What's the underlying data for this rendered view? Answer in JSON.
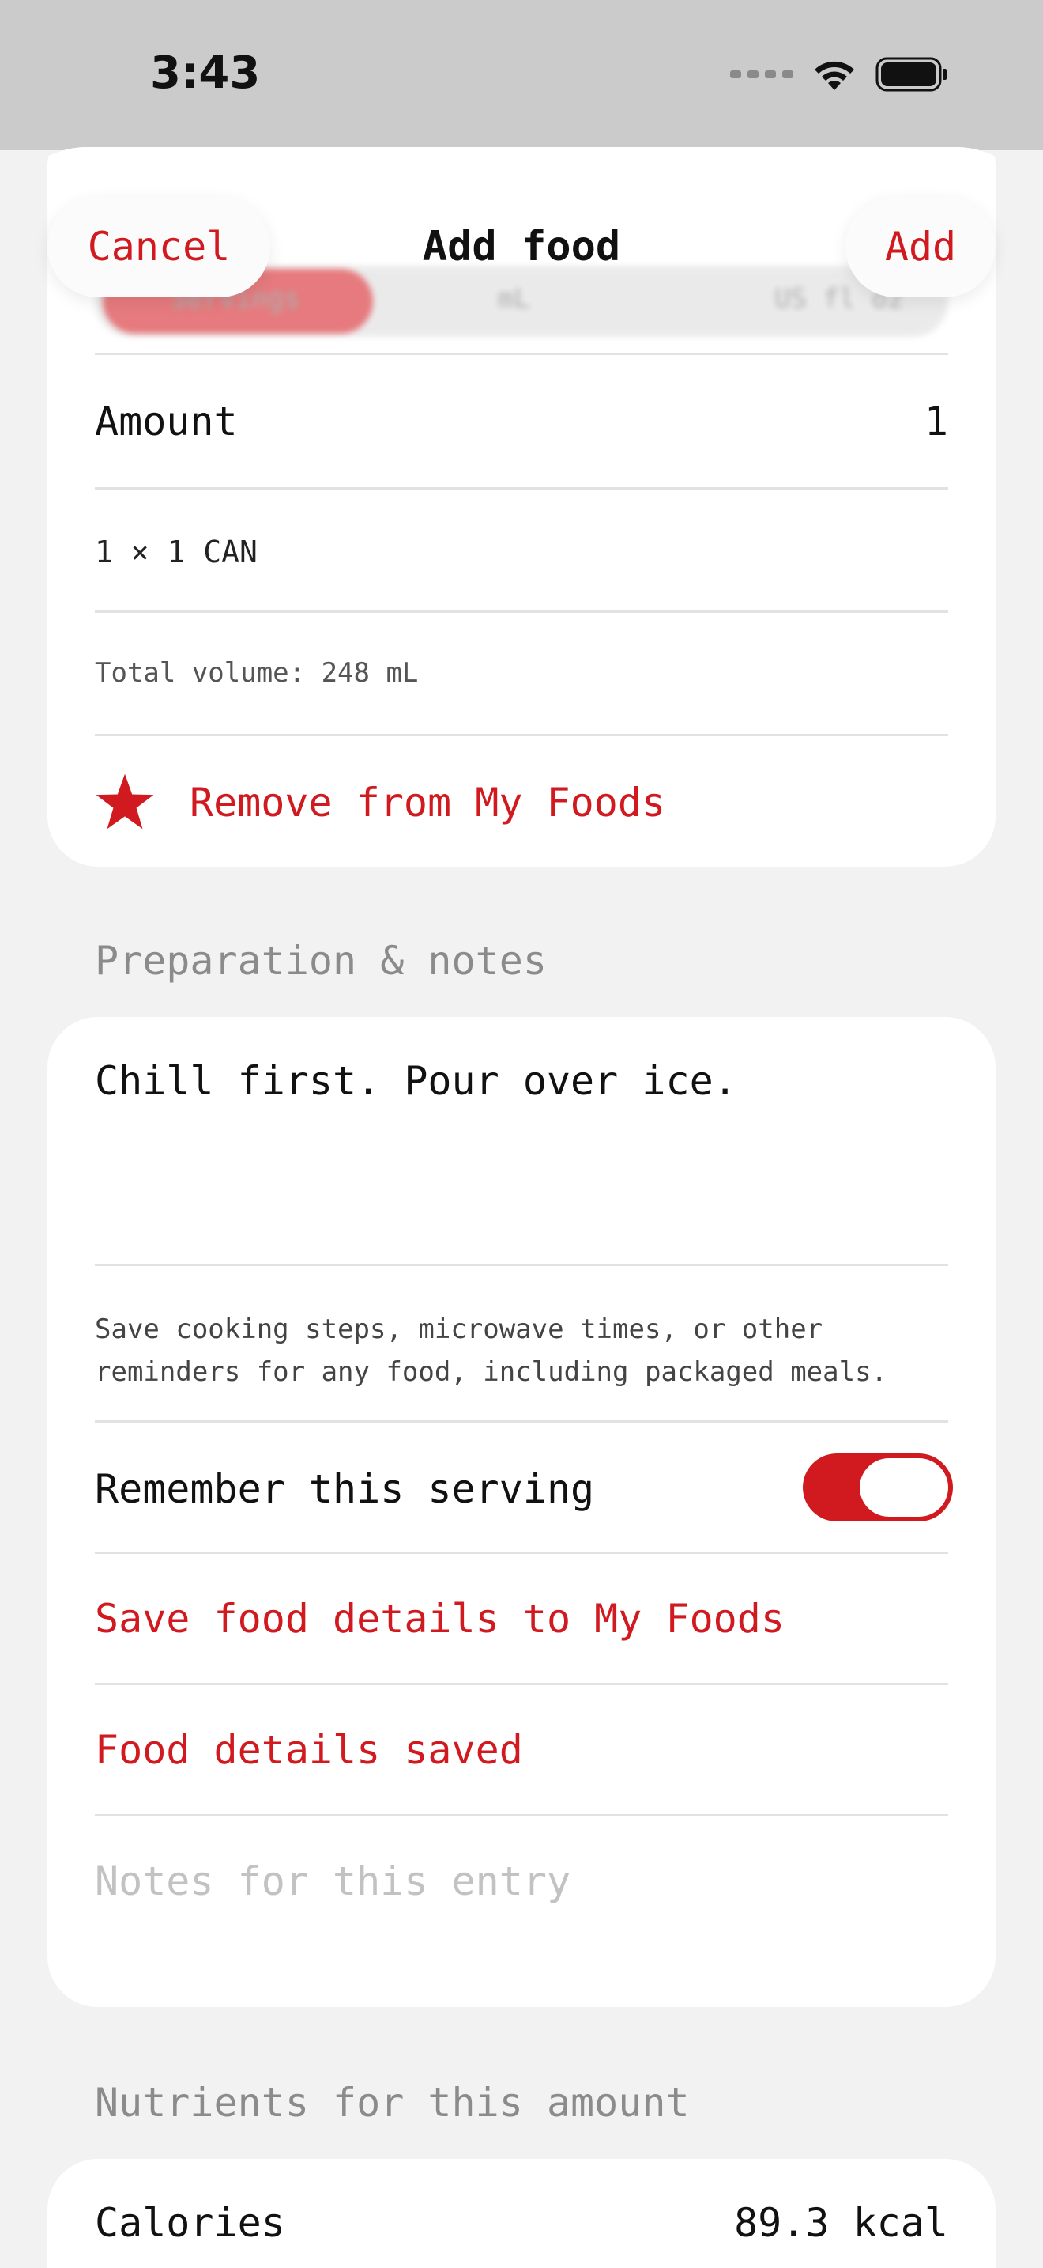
{
  "status": {
    "time": "3:43"
  },
  "header": {
    "cancel_label": "Cancel",
    "title": "Add food",
    "add_label": "Add"
  },
  "segmented": {
    "options": [
      "Servings",
      "mL",
      "US fl oz"
    ],
    "selected": "Servings"
  },
  "serving_card": {
    "amount_label": "Amount",
    "amount_value": "1",
    "serving_desc": "1 × 1 CAN",
    "total_volume": "Total volume: 248 mL",
    "remove_label": "Remove from My Foods"
  },
  "preparation": {
    "section_label": "Preparation & notes",
    "notes_text": "Chill first. Pour over ice.",
    "help_text": "Save cooking steps, microwave times, or other reminders for any food, including packaged meals.",
    "remember_label": "Remember this serving",
    "remember_on": true,
    "save_details_label": "Save food details to My Foods",
    "details_saved_label": "Food details saved",
    "entry_notes_placeholder": "Notes for this entry"
  },
  "nutrients": {
    "section_label": "Nutrients for this amount",
    "calories_label": "Calories",
    "calories_value": "89.3 kcal"
  },
  "colors": {
    "accent": "#d11a1f",
    "background": "#f2f2f2",
    "card": "#ffffff"
  },
  "icons": {
    "favorite": "star-icon"
  }
}
